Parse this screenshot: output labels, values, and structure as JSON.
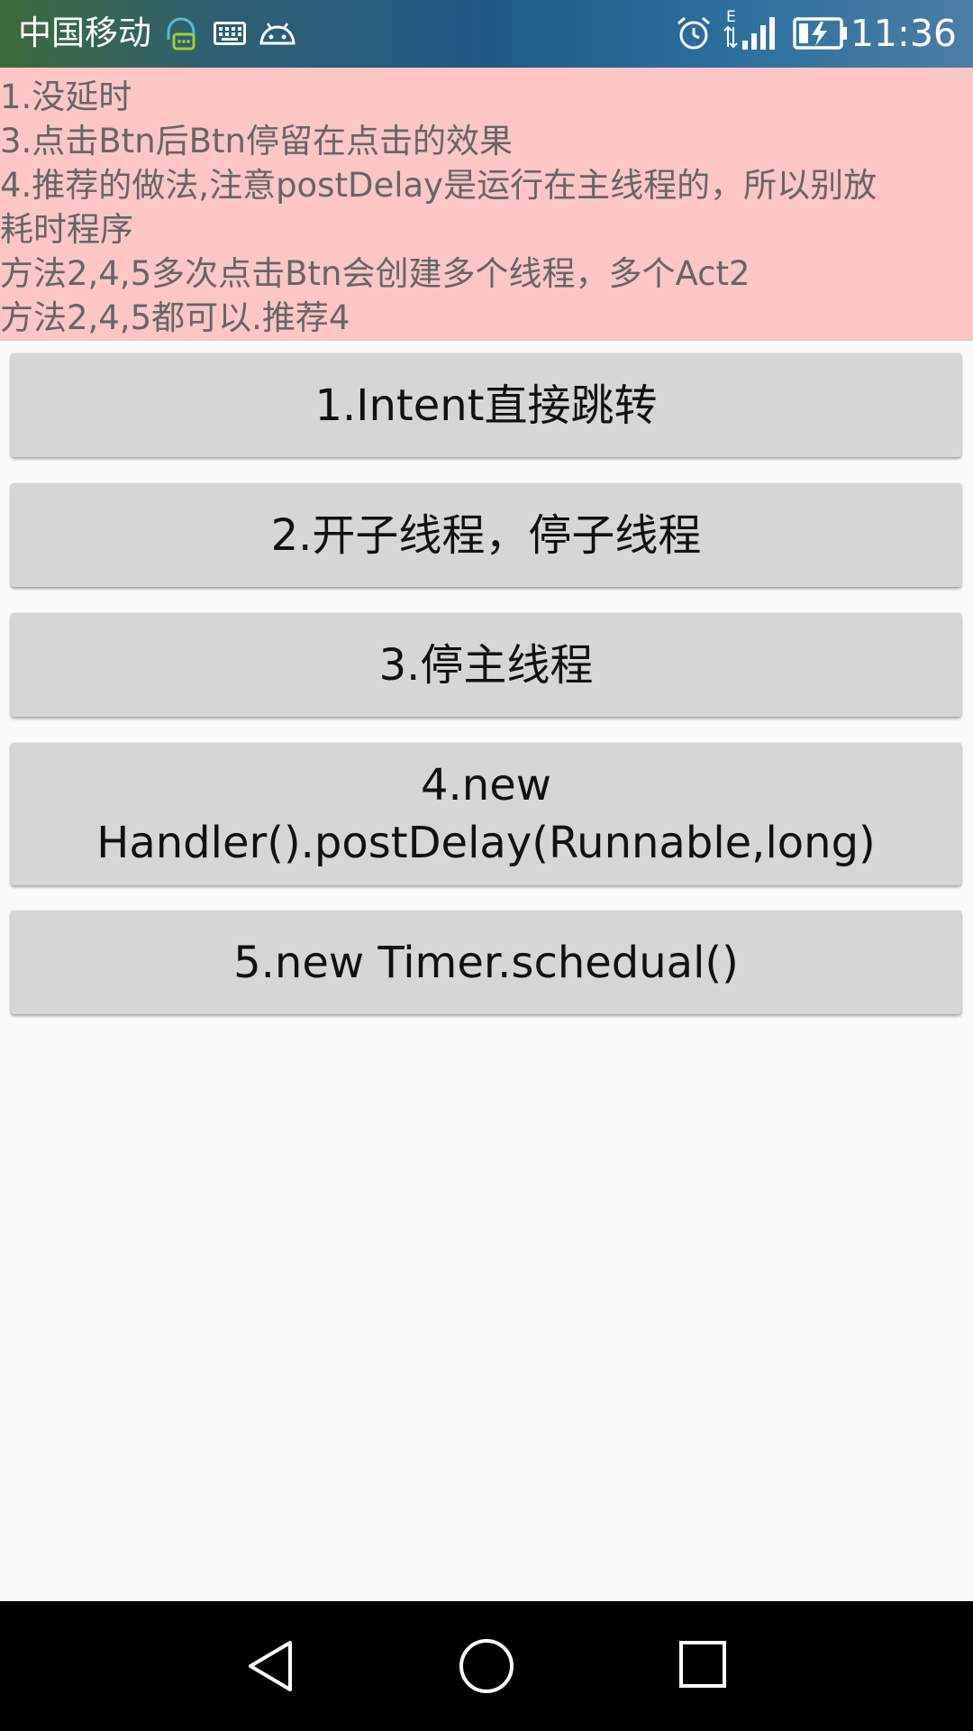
{
  "status_bar": {
    "carrier": "中国移动",
    "time": "11:36",
    "network_type": "E",
    "icons": [
      "chat-notification-icon",
      "keyboard-icon",
      "android-icon",
      "alarm-icon",
      "data-arrows-icon",
      "signal-icon",
      "battery-charging-icon"
    ]
  },
  "info_panel": {
    "lines": [
      "1.没延时",
      "3.点击Btn后Btn停留在点击的效果",
      "4.推荐的做法,注意postDelay是运行在主线程的，所以别放",
      "耗时程序",
      "方法2,4,5多次点击Btn会创建多个线程，多个Act2",
      "方法2,4,5都可以.推荐4"
    ],
    "background_color": "#fcc6c6"
  },
  "buttons": [
    {
      "label": "1.Intent直接跳转"
    },
    {
      "label": "2.开子线程，停子线程"
    },
    {
      "label": "3.停主线程"
    },
    {
      "label_line1": "4.new",
      "label_line2": "Handler().postDelay(Runnable,long)"
    },
    {
      "label": "5.new Timer.schedual()"
    }
  ],
  "nav_bar": {
    "icons": [
      "back-icon",
      "home-icon",
      "recents-icon"
    ]
  }
}
